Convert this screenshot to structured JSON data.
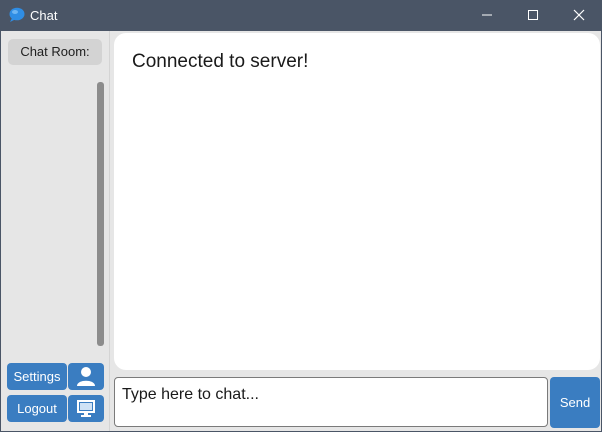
{
  "window": {
    "title": "Chat",
    "icon": "chat-bubble-icon",
    "controls": [
      "minimize-icon",
      "maximize-icon",
      "close-icon"
    ]
  },
  "sidebar": {
    "room_label": "Chat Room:",
    "settings_label": "Settings",
    "logout_label": "Logout",
    "profile_icon": "user-icon",
    "server_icon": "monitor-icon"
  },
  "chat": {
    "messages": [
      "Connected to server!"
    ]
  },
  "composer": {
    "placeholder": "Type here to chat...",
    "send_label": "Send"
  },
  "colors": {
    "titlebar": "#4a5566",
    "accent": "#3a7dc1",
    "panel": "#e6e6e6",
    "chat_bg": "#ffffff"
  }
}
